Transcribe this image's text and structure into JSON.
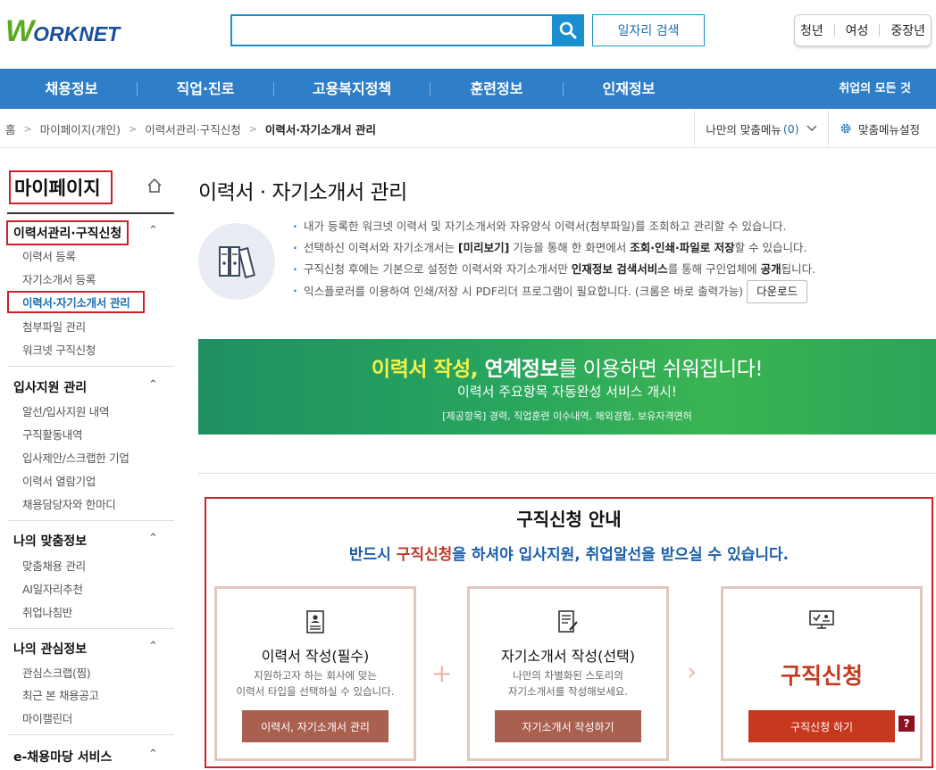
{
  "header": {
    "logo_w": "W",
    "logo_text": "ORKNET",
    "search_placeholder": "",
    "job_search": "일자리 검색",
    "segments": [
      "청년",
      "여성",
      "중장년"
    ]
  },
  "nav": {
    "items": [
      "채용정보",
      "직업·진로",
      "고용복지정책",
      "훈련정보",
      "인재정보"
    ],
    "all": "취업의 모든 것"
  },
  "breadcrumb": {
    "items": [
      "홈",
      "마이페이지(개인)",
      "이력서관리·구직신청",
      "이력서·자기소개서 관리"
    ],
    "mymenu": "나만의 맞춤메뉴",
    "mymenu_count": "(0)",
    "setting": "맞춤메뉴설정"
  },
  "sidebar": {
    "title": "마이페이지",
    "groups": [
      {
        "title": "이력서관리·구직신청",
        "items": [
          "이력서 등록",
          "자기소개서 등록",
          "이력서·자기소개서 관리",
          "첨부파일 관리",
          "워크넷 구직신청"
        ]
      },
      {
        "title": "입사지원 관리",
        "items": [
          "알선/입사지원 내역",
          "구직활동내역",
          "입사제안/스크랩한 기업",
          "이력서 열람기업",
          "채용담당자와 한마디"
        ]
      },
      {
        "title": "나의 맞춤정보",
        "items": [
          "맞춤채용 관리",
          "AI일자리추천",
          "취업나침반"
        ]
      },
      {
        "title": "나의 관심정보",
        "items": [
          "관심스크랩(찜)",
          "최근 본 채용공고",
          "마이캘린더"
        ]
      },
      {
        "title": "e-채용마당 서비스",
        "items": []
      }
    ]
  },
  "main": {
    "title": "이력서 · 자기소개서 관리",
    "info": {
      "l1": "내가 등록한 워크넷 이력서 및 자기소개서와 자유양식 이력서(첨부파일)를 조회하고 관리할 수 있습니다.",
      "l2a": "선택하신 이력서와 자기소개서는 ",
      "l2b": "[미리보기]",
      "l2c": " 기능을 통해 한 화면에서 ",
      "l2d": "조회·인쇄·파일로 저장",
      "l2e": "할 수 있습니다.",
      "l3a": "구직신청 후에는 기본으로 설정한 이력서와 자기소개서만 ",
      "l3b": "인재정보 검색서비스",
      "l3c": "를 통해 구인업체에 ",
      "l3d": "공개",
      "l3e": "됩니다.",
      "l4": "익스플로러를 이용하여 인쇄/저장 시 PDF리더 프로그램이 필요합니다. (크롬은 바로 출력가능)",
      "download": "다운로드"
    },
    "banner": {
      "y1": "이력서 작성,",
      "w1": " 연계정보",
      "rest": "를 이용하면 쉬워집니다!",
      "line2": "이력서 주요항목 자동완성 서비스 개시!",
      "line3": "[제공항목] 경력, 직업훈련 이수내역, 해외경험, 보유자격면허"
    },
    "guide": {
      "title": "구직신청 안내",
      "sub_a": "반드시 ",
      "sub_b": "구직신청",
      "sub_c": "을 하셔야 입사지원, 취업알선을 받으실 수 있습니다.",
      "cards": [
        {
          "title": "이력서 작성(필수)",
          "desc1": "지원하고자 하는 회사에 맞는",
          "desc2": "이력서 타입을 선택하실 수 있습니다.",
          "button": "이력서, 자기소개서 관리"
        },
        {
          "title": "자기소개서 작성(선택)",
          "desc1": "나만의 차별화된 스토리의",
          "desc2": "자기소개서를 작성해보세요.",
          "button": "자기소개서 작성하기"
        },
        {
          "title": "구직신청",
          "button": "구직신청 하기"
        }
      ],
      "help": "?"
    }
  },
  "colors": {
    "nav_blue": "#2f7ec8",
    "highlight_red": "#d0202a",
    "button_brown": "#a9604f",
    "apply_orange": "#c6391e"
  }
}
